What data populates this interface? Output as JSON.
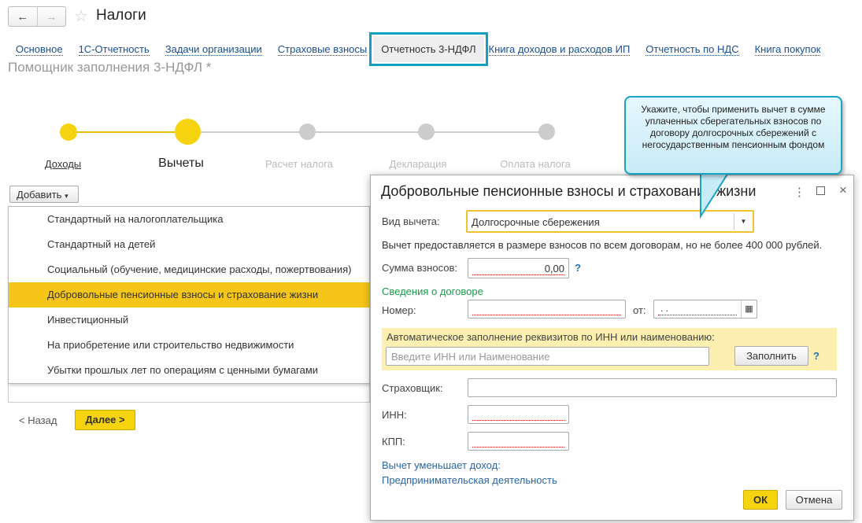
{
  "header": {
    "title": "Налоги",
    "back_icon": "arrow-left",
    "forward_icon": "arrow-right",
    "favorite_icon": "star"
  },
  "tabs": [
    "Основное",
    "1С-Отчетность",
    "Задачи организации",
    "Страховые взносы",
    "Отчетность 3-НДФЛ",
    "Книга доходов и расходов ИП",
    "Отчетность по НДС",
    "Книга покупок"
  ],
  "active_tab": "Отчетность 3-НДФЛ",
  "subtitle": "Помощник заполнения 3-НДФЛ *",
  "steps": [
    "Доходы",
    "Вычеты",
    "Расчет налога",
    "Декларация",
    "Оплата налога"
  ],
  "current_step": "Вычеты",
  "add_button": "Добавить",
  "menu": [
    "Стандартный на налогоплательщика",
    "Стандартный на детей",
    "Социальный (обучение, медицинские расходы, пожертвования)",
    "Добровольные пенсионные взносы и страхование жизни",
    "Инвестиционный",
    "На приобретение или строительство недвижимости",
    "Убытки прошлых лет по операциям с ценными бумагами"
  ],
  "selected_menu": "Добровольные пенсионные взносы и страхование жизни",
  "nav": {
    "back": "< Назад",
    "next": "Далее >"
  },
  "dialog": {
    "title": "Добровольные пенсионные взносы и страхование жизни",
    "type_label": "Вид вычета:",
    "type_value": "Долгосрочные сбережения",
    "note": "Вычет предоставляется в размере взносов по всем договорам, но не более 400 000 рублей.",
    "sum_label": "Сумма взносов:",
    "sum_value": "0,00",
    "help": "?",
    "contract_header": "Сведения о договоре",
    "number_label": "Номер:",
    "date_label": "от:",
    "date_value": " .  .",
    "autofill_label": "Автоматическое заполнение реквизитов по ИНН или наименованию:",
    "autofill_placeholder": "Введите ИНН или Наименование",
    "fill_button": "Заполнить",
    "insurer_label": "Страховщик:",
    "inn_label": "ИНН:",
    "kpp_label": "КПП:",
    "reduces_label": "Вычет уменьшает доход:",
    "reduces_value": "Предпринимательская деятельность",
    "ok": "ОК",
    "cancel": "Отмена"
  },
  "callout": "Укажите, чтобы применить вычет в сумме уплаченных сберегательных взносов по договору долгосрочных сбережений с негосударственным пенсионным фондом",
  "colors": {
    "accent": "#f5c518",
    "highlight": "#12a1c0",
    "link": "#1a4f8f"
  }
}
